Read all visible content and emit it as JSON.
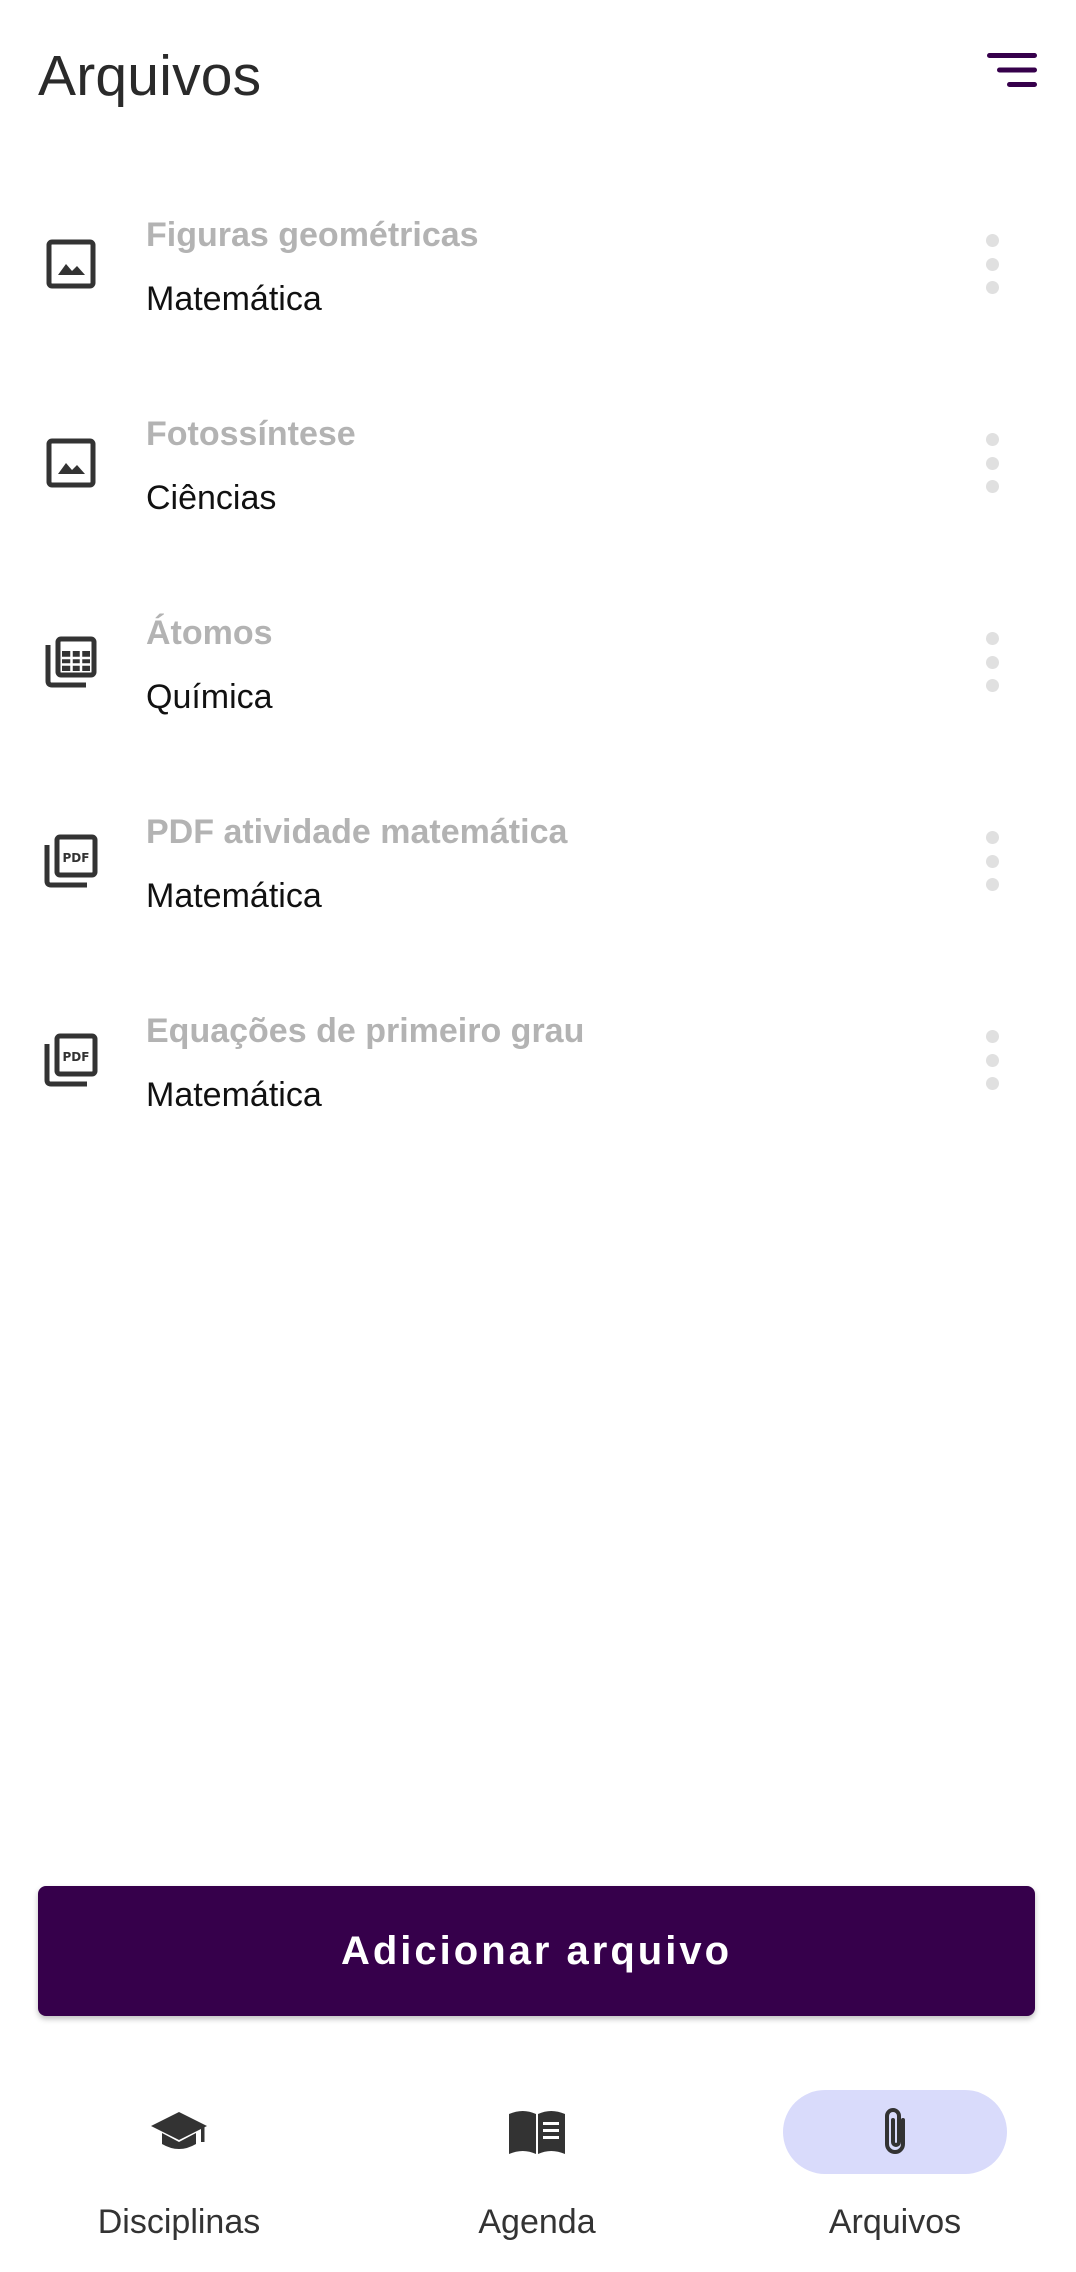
{
  "header": {
    "title": "Arquivos",
    "menu_icon": "sort-lines-icon"
  },
  "files": [
    {
      "title": "Figuras geométricas",
      "subject": "Matemática",
      "icon": "image-icon"
    },
    {
      "title": "Fotossíntese",
      "subject": "Ciências",
      "icon": "image-icon"
    },
    {
      "title": "Átomos",
      "subject": "Química",
      "icon": "spreadsheet-icon"
    },
    {
      "title": "PDF atividade matemática",
      "subject": "Matemática",
      "icon": "pdf-icon"
    },
    {
      "title": "Equações de primeiro grau",
      "subject": "Matemática",
      "icon": "pdf-icon"
    }
  ],
  "actions": {
    "add_label": "Adicionar arquivo"
  },
  "bottom_nav": {
    "items": [
      {
        "label": "Disciplinas",
        "icon": "graduation-cap-icon",
        "active": false
      },
      {
        "label": "Agenda",
        "icon": "book-icon",
        "active": false
      },
      {
        "label": "Arquivos",
        "icon": "paperclip-icon",
        "active": true
      }
    ]
  },
  "colors": {
    "primary": "#36004b",
    "nav_active_bg": "#d9dbfb",
    "title_muted": "#b3b3b3",
    "text": "#111111"
  }
}
